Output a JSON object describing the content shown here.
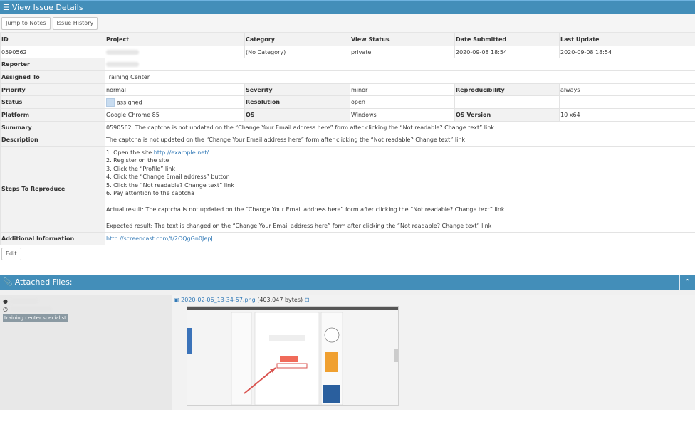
{
  "header": {
    "title": "View Issue Details",
    "menu_icon": "bars-icon"
  },
  "toolbar": {
    "jump_label": "Jump to Notes",
    "history_label": "Issue History"
  },
  "table": {
    "headers": [
      "ID",
      "Project",
      "Category",
      "View Status",
      "Date Submitted",
      "Last Update"
    ],
    "id_value": "0590562",
    "category": "(No Category)",
    "view_status": "private",
    "date_submitted": "2020-09-08 18:54",
    "last_update": "2020-09-08 18:54",
    "reporter_label": "Reporter",
    "assigned_label": "Assigned To",
    "assigned_value": "Training Center",
    "priority_label": "Priority",
    "priority_value": "normal",
    "severity_label": "Severity",
    "severity_value": "minor",
    "repro_label": "Reproducibility",
    "repro_value": "always",
    "status_label": "Status",
    "status_value": "assigned",
    "resolution_label": "Resolution",
    "resolution_value": "open",
    "platform_label": "Platform",
    "platform_value": "Google Chrome 85",
    "os_label": "OS",
    "os_value": "Windows",
    "osver_label": "OS Version",
    "osver_value": "10 x64",
    "summary_label": "Summary",
    "summary_value": "0590562: The captcha is not updated on the “Change Your Email address here” form after clicking the “Not readable? Change text” link",
    "description_label": "Description",
    "description_value": "The captcha is not updated on the “Change Your Email address here” form after clicking the “Not readable? Change text” link",
    "steps_label": "Steps To Reproduce",
    "steps": {
      "step1_prefix": "1. Open the site ",
      "step1_link": "http://example.net/",
      "step2": "2. Register on the site",
      "step3": "3. Click the “Profile” link",
      "step4": "4. Click the “Change Email address” button",
      "step5": "5. Click the “Not readable? Change text” link",
      "step6": "6. Pay attention to the captcha",
      "actual": "Actual result: The captcha is not updated on the “Change Your Email address here” form after clicking the “Not readable? Change text” link",
      "expected": "Expected result: The text is changed on the “Change Your Email address here” form after clicking the “Not readable? Change text” link"
    },
    "additional_label": "Additional Information",
    "additional_link": "http://screencast.com/t/2OQgGn0JepJ"
  },
  "edit_label": "Edit",
  "attachments": {
    "title": "Attached Files:",
    "icon": "paperclip-icon",
    "role_badge": "training center specialist",
    "file_name": "2020-02-06_13-34-57.png",
    "file_size": "(403,047 bytes)"
  }
}
